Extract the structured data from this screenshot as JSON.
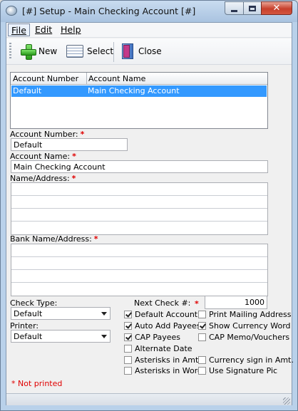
{
  "window": {
    "title": "[#] Setup - Main Checking Account [#]",
    "minimize_label": "",
    "maximize_label": "",
    "close_label": "✕"
  },
  "menu": {
    "items": [
      {
        "label": "File",
        "hot": "F"
      },
      {
        "label": "Edit",
        "hot": "E"
      },
      {
        "label": "Help",
        "hot": "H"
      }
    ]
  },
  "toolbar": {
    "new_label": "New",
    "select_label": "Select",
    "close_label": "Close"
  },
  "accounts": {
    "columns": [
      "Account Number",
      "Account Name"
    ],
    "rows": [
      {
        "number": "Default",
        "name": "Main Checking Account",
        "selected": true
      }
    ]
  },
  "form": {
    "account_number_label": "Account Number:",
    "account_number_value": "Default",
    "account_name_label": "Account Name:",
    "account_name_value": "Main Checking Account",
    "name_address_label": "Name/Address:",
    "bank_label": "Bank Name/Address:",
    "required_mark": "*",
    "check_type_label": "Check Type:",
    "check_type_value": "Default",
    "printer_label": "Printer:",
    "printer_value": "Default",
    "next_check_label": "Next Check #:",
    "next_check_value": "1000",
    "not_printed_note": "* Not printed"
  },
  "options": {
    "default_account": {
      "label": "Default Account",
      "checked": true
    },
    "print_mailing_address": {
      "label": "Print Mailing Address",
      "checked": false
    },
    "auto_add_payees": {
      "label": "Auto Add Payees",
      "checked": true
    },
    "show_currency_word": {
      "label": "Show Currency Word",
      "checked": true
    },
    "cap_payees": {
      "label": "CAP Payees",
      "checked": true
    },
    "cap_memo_vouchers": {
      "label": "CAP Memo/Vouchers",
      "checked": false
    },
    "alternate_date": {
      "label": "Alternate Date",
      "checked": false
    },
    "asterisks_in_amt": {
      "label": "Asterisks in Amt.",
      "checked": false
    },
    "currency_sign_in_amt": {
      "label": "Currency sign in Amt.",
      "checked": false
    },
    "asterisks_in_words": {
      "label": "Asterisks in Words",
      "checked": false
    },
    "use_signature_pic": {
      "label": "Use Signature Pic",
      "checked": false
    }
  },
  "colors": {
    "selection": "#3399ff",
    "required": "#e00000",
    "frame": "#b9d1ea"
  }
}
